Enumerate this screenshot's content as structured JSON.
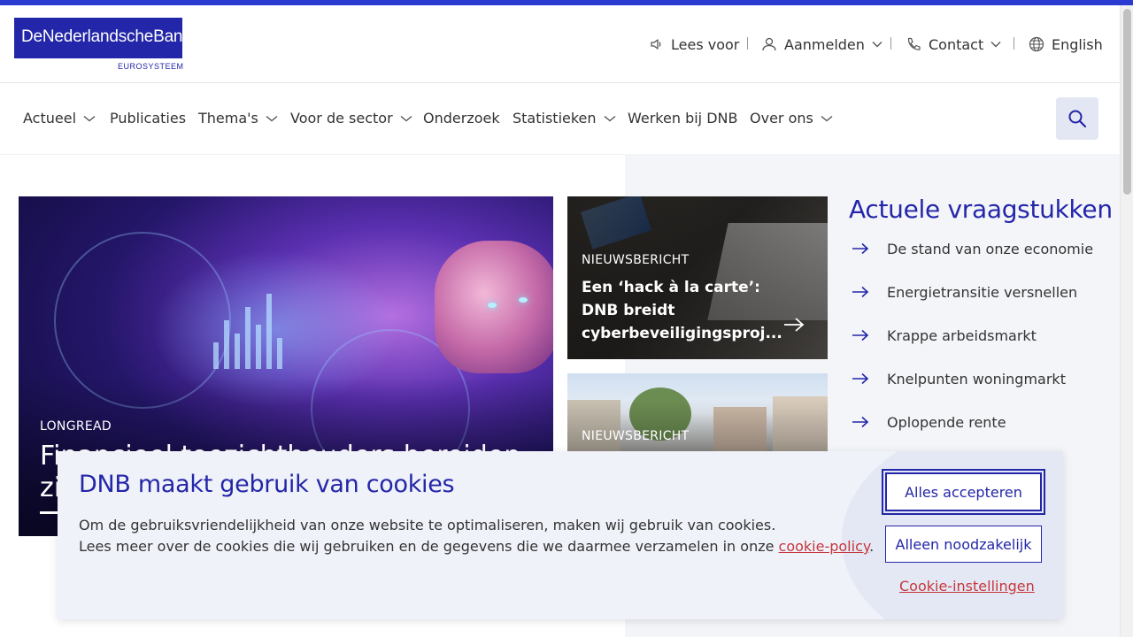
{
  "header": {
    "logo_text": "DeNederlandscheBank",
    "logo_subtext": "EUROSYSTEEM",
    "utility": {
      "read_aloud": "Lees voor",
      "login": "Aanmelden",
      "contact": "Contact",
      "language": "English"
    }
  },
  "nav": {
    "items": [
      {
        "label": "Actueel"
      },
      {
        "label": "Publicaties"
      },
      {
        "label": "Thema's"
      },
      {
        "label": "Voor de sector"
      },
      {
        "label": "Onderzoek"
      },
      {
        "label": "Statistieken"
      },
      {
        "label": "Werken bij DNB"
      },
      {
        "label": "Over ons"
      }
    ]
  },
  "hero": {
    "tag": "LONGREAD",
    "title": "Financieel toezichthouders bereiden zich voor"
  },
  "news": [
    {
      "tag": "NIEUWSBERICHT",
      "title": "Een ‘hack à la carte’: DNB breidt cyberbeveiligingsproj..."
    },
    {
      "tag": "NIEUWSBERICHT"
    }
  ],
  "issues": {
    "title": "Actuele vraagstukken",
    "items": [
      "De stand van onze economie",
      "Energietransitie versnellen",
      "Krappe arbeidsmarkt",
      "Knelpunten woningmarkt",
      "Oplopende rente"
    ]
  },
  "cookie": {
    "title": "DNB maakt gebruik van cookies",
    "line1": "Om de gebruiksvriendelijkheid van onze website te optimaliseren, maken wij gebruik van cookies.",
    "line2_prefix": "Lees meer over de cookies die wij gebruiken en de gegevens die we daarmee verzamelen in onze ",
    "line2_link": "cookie-policy",
    "line2_suffix": ".",
    "accept_all": "Alles accepteren",
    "necessary_only": "Alleen noodzakelijk",
    "settings": "Cookie-instellingen"
  },
  "colors": {
    "brand_blue": "#2326a8",
    "accent_stripe": "#2b3bd1",
    "link_red": "#c6373c"
  },
  "icons": {
    "read_aloud": "speaker-icon",
    "login": "user-icon",
    "contact": "phone-icon",
    "language": "globe-icon",
    "search": "search-icon",
    "issue_bullet": "arrow-right-icon"
  }
}
